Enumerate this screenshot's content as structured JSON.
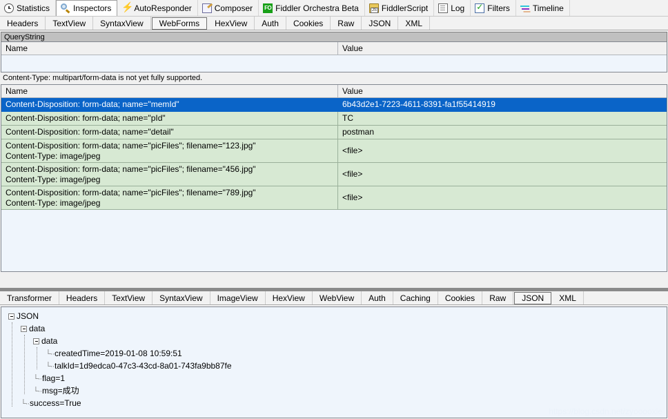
{
  "toolbar": {
    "tabs": [
      {
        "label": "Statistics",
        "icon": "clock-icon",
        "selected": false
      },
      {
        "label": "Inspectors",
        "icon": "magnifier-icon",
        "selected": true
      },
      {
        "label": "AutoResponder",
        "icon": "lightning-bolt-icon",
        "selected": false
      },
      {
        "label": "Composer",
        "icon": "pencil-note-icon",
        "selected": false
      },
      {
        "label": "Fiddler Orchestra Beta",
        "icon": "fo-badge-icon",
        "selected": false
      },
      {
        "label": "FiddlerScript",
        "icon": "script-icon",
        "selected": false
      },
      {
        "label": "Log",
        "icon": "log-icon",
        "selected": false
      },
      {
        "label": "Filters",
        "icon": "checkbox-filter-icon",
        "selected": false
      },
      {
        "label": "Timeline",
        "icon": "timeline-icon",
        "selected": false
      }
    ]
  },
  "request_tabs": [
    {
      "label": "Headers",
      "selected": false
    },
    {
      "label": "TextView",
      "selected": false
    },
    {
      "label": "SyntaxView",
      "selected": false
    },
    {
      "label": "WebForms",
      "selected": true
    },
    {
      "label": "HexView",
      "selected": false
    },
    {
      "label": "Auth",
      "selected": false
    },
    {
      "label": "Cookies",
      "selected": false
    },
    {
      "label": "Raw",
      "selected": false
    },
    {
      "label": "JSON",
      "selected": false
    },
    {
      "label": "XML",
      "selected": false
    }
  ],
  "querystring": {
    "section_title": "QueryString",
    "columns": [
      "Name",
      "Value"
    ],
    "rows": []
  },
  "body_note": "Content-Type: multipart/form-data is not yet fully supported.",
  "formdata": {
    "columns": [
      "Name",
      "Value"
    ],
    "rows": [
      {
        "name": "Content-Disposition: form-data; name=\"memId\"",
        "value": "6b43d2e1-7223-4611-8391-fa1f55414919",
        "selected": true,
        "tall": false
      },
      {
        "name": "Content-Disposition: form-data; name=\"pId\"",
        "value": "TC",
        "selected": false,
        "tall": false
      },
      {
        "name": "Content-Disposition: form-data; name=\"detail\"",
        "value": "postman",
        "selected": false,
        "tall": false
      },
      {
        "name": "Content-Disposition: form-data; name=\"picFiles\"; filename=\"123.jpg\"\nContent-Type: image/jpeg",
        "value": "<file>",
        "selected": false,
        "tall": true
      },
      {
        "name": "Content-Disposition: form-data; name=\"picFiles\"; filename=\"456.jpg\"\nContent-Type: image/jpeg",
        "value": "<file>",
        "selected": false,
        "tall": true
      },
      {
        "name": "Content-Disposition: form-data; name=\"picFiles\"; filename=\"789.jpg\"\nContent-Type: image/jpeg",
        "value": "<file>",
        "selected": false,
        "tall": true
      }
    ]
  },
  "response_tabs": [
    {
      "label": "Transformer",
      "selected": false
    },
    {
      "label": "Headers",
      "selected": false
    },
    {
      "label": "TextView",
      "selected": false
    },
    {
      "label": "SyntaxView",
      "selected": false
    },
    {
      "label": "ImageView",
      "selected": false
    },
    {
      "label": "HexView",
      "selected": false
    },
    {
      "label": "WebView",
      "selected": false
    },
    {
      "label": "Auth",
      "selected": false
    },
    {
      "label": "Caching",
      "selected": false
    },
    {
      "label": "Cookies",
      "selected": false
    },
    {
      "label": "Raw",
      "selected": false
    },
    {
      "label": "JSON",
      "selected": true
    },
    {
      "label": "XML",
      "selected": false
    }
  ],
  "json_tree": [
    {
      "depth": 0,
      "label": "JSON",
      "expander": true
    },
    {
      "depth": 1,
      "label": "data",
      "expander": true
    },
    {
      "depth": 2,
      "label": "data",
      "expander": true
    },
    {
      "depth": 3,
      "label": "createdTime=2019-01-08 10:59:51",
      "expander": false
    },
    {
      "depth": 3,
      "label": "talkId=1d9edca0-47c3-43cd-8a01-743fa9bb87fe",
      "expander": false
    },
    {
      "depth": 2,
      "label": "flag=1",
      "expander": false
    },
    {
      "depth": 2,
      "label": "msg=成功",
      "expander": false
    },
    {
      "depth": 1,
      "label": "success=True",
      "expander": false
    }
  ],
  "watermark": "https://blog.csdn.net/zyooooxie",
  "colors": {
    "selection_blue": "#0a64c8",
    "row_green": "#d7e9d3",
    "pane_bg": "#eff5fc",
    "chrome": "#f0f0f0",
    "splitter": "#8a8a8a"
  }
}
